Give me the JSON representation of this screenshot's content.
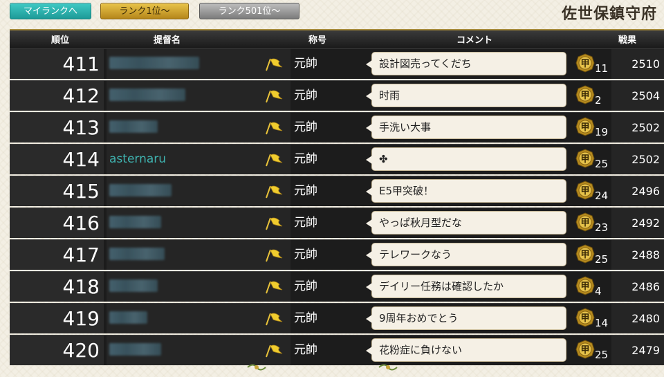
{
  "tabs": {
    "my_rank": "マイランクへ",
    "rank_top": "ランク1位～",
    "rank_501": "ランク501位～"
  },
  "page_title": "佐世保鎮守府",
  "headers": {
    "rank": "順位",
    "admiral": "提督名",
    "title": "称号",
    "comment": "コメント",
    "score": "戦果"
  },
  "colors": {
    "accent_teal": "#3fb3b0",
    "gold": "#d9b43a"
  },
  "rows": [
    {
      "rank": "411",
      "name": "",
      "title": "元帥",
      "comment": "設計図売ってくだち",
      "medal_count": "11",
      "score": "2510"
    },
    {
      "rank": "412",
      "name": "",
      "title": "元帥",
      "comment": "时雨",
      "medal_count": "2",
      "score": "2504"
    },
    {
      "rank": "413",
      "name": "",
      "title": "元帥",
      "comment": "手洗い大事",
      "medal_count": "19",
      "score": "2502"
    },
    {
      "rank": "414",
      "name": "asternaru",
      "title": "元帥",
      "comment": "✤",
      "medal_count": "25",
      "score": "2502"
    },
    {
      "rank": "415",
      "name": "",
      "title": "元帥",
      "comment": "E5甲突破！",
      "medal_count": "24",
      "score": "2496"
    },
    {
      "rank": "416",
      "name": "",
      "title": "元帥",
      "comment": "やっぱ秋月型だな",
      "medal_count": "23",
      "score": "2492"
    },
    {
      "rank": "417",
      "name": "",
      "title": "元帥",
      "comment": "テレワークなう",
      "medal_count": "25",
      "score": "2488"
    },
    {
      "rank": "418",
      "name": "",
      "title": "元帥",
      "comment": "デイリー任務は確認したか",
      "medal_count": "4",
      "score": "2486"
    },
    {
      "rank": "419",
      "name": "",
      "title": "元帥",
      "comment": "9周年おめでとう",
      "medal_count": "14",
      "score": "2480"
    },
    {
      "rank": "420",
      "name": "",
      "title": "元帥",
      "comment": "花粉症に負けない",
      "medal_count": "25",
      "score": "2479"
    }
  ],
  "medal_glyph": "甲"
}
